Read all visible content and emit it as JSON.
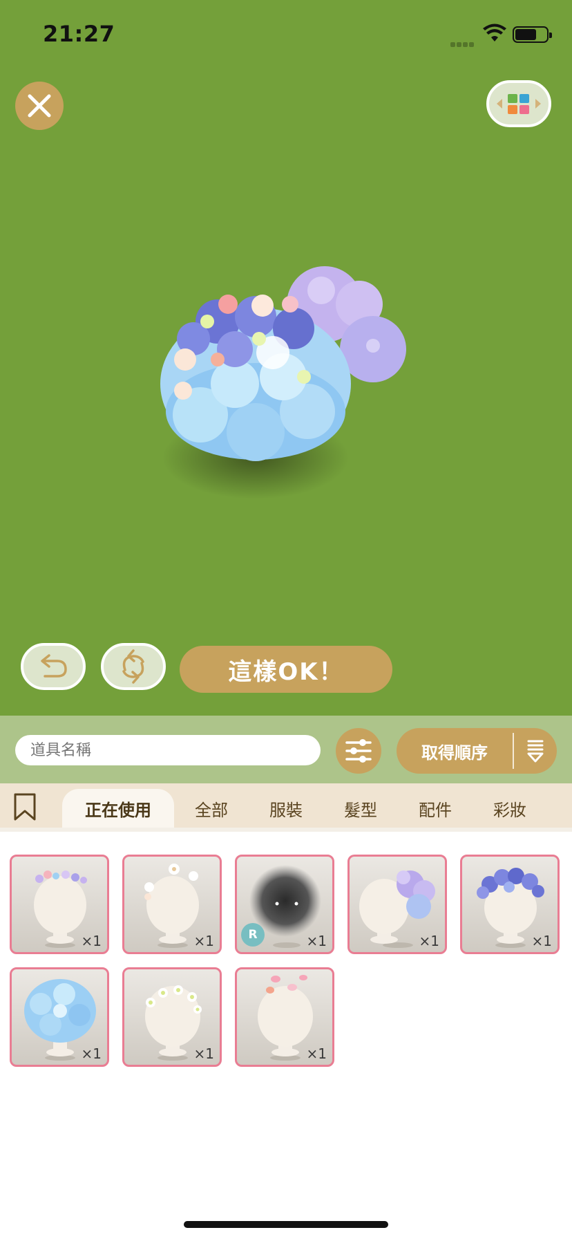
{
  "status_bar": {
    "time": "21:27"
  },
  "actions": {
    "ok_label": "這樣OK！"
  },
  "search": {
    "placeholder": "道具名稱"
  },
  "sort": {
    "label": "取得順序"
  },
  "tabs": [
    {
      "label": "正在使用",
      "active": true
    },
    {
      "label": "全部",
      "active": false
    },
    {
      "label": "服裝",
      "active": false
    },
    {
      "label": "髮型",
      "active": false
    },
    {
      "label": "配件",
      "active": false
    },
    {
      "label": "彩妝",
      "active": false
    }
  ],
  "items": [
    {
      "thumb": "flower-crown-small",
      "qty": "×1"
    },
    {
      "thumb": "flower-pins-white",
      "qty": "×1"
    },
    {
      "thumb": "dark-fluff-face",
      "qty": "×1",
      "rarity": "R"
    },
    {
      "thumb": "hydrangea-side-purple",
      "qty": "×1"
    },
    {
      "thumb": "hydrangea-crown-blue-purple",
      "qty": "×1"
    },
    {
      "thumb": "hydrangea-hair-blue",
      "qty": "×1"
    },
    {
      "thumb": "daisy-crown-white",
      "qty": "×1"
    },
    {
      "thumb": "petals-pink",
      "qty": "×1"
    }
  ],
  "colors": {
    "stage_bg": "#74a03a",
    "accent_gold": "#c7a25d",
    "item_border": "#e97d93",
    "rarity_badge": "#78bec1"
  }
}
